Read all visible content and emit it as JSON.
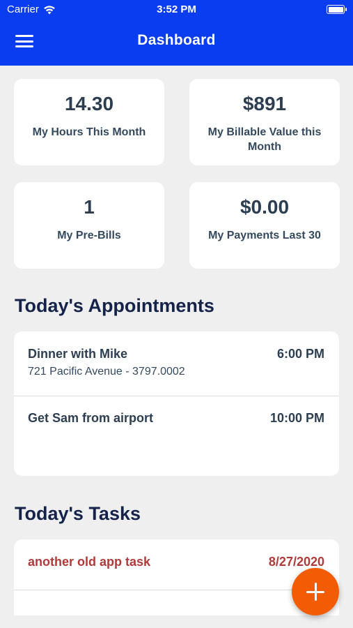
{
  "status_bar": {
    "carrier": "Carrier",
    "time": "3:52 PM"
  },
  "header": {
    "title": "Dashboard",
    "menu_icon": "hamburger-menu-icon",
    "background_color": "#0a3df0"
  },
  "stats": [
    {
      "value": "14.30",
      "label": "My Hours This Month"
    },
    {
      "value": "$891",
      "label": "My Billable Value this Month"
    },
    {
      "value": "1",
      "label": "My Pre-Bills"
    },
    {
      "value": "$0.00",
      "label": "My Payments Last 30"
    }
  ],
  "appointments": {
    "title": "Today's Appointments",
    "items": [
      {
        "title": "Dinner with Mike",
        "subtitle": "721 Pacific Avenue - 3797.0002",
        "time": "6:00 PM"
      },
      {
        "title": "Get Sam from airport",
        "subtitle": "",
        "time": "10:00 PM"
      }
    ]
  },
  "tasks": {
    "title": "Today's Tasks",
    "color": "#b03a3a",
    "items": [
      {
        "title": "another old app task",
        "date": "8/27/2020"
      }
    ]
  },
  "fab": {
    "icon": "plus-icon",
    "color": "#f25c05"
  }
}
